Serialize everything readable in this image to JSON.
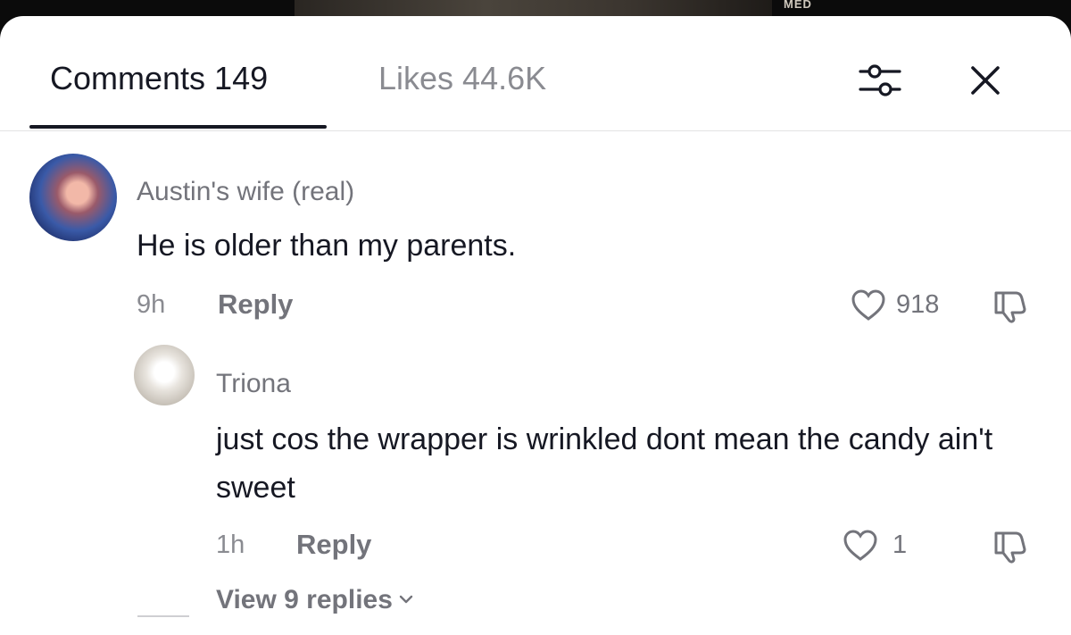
{
  "video": {
    "thumb_text": "MED"
  },
  "header": {
    "tabs": [
      {
        "label": "Comments 149",
        "active": true
      },
      {
        "label": "Likes 44.6K",
        "active": false
      }
    ],
    "filter_icon": "sliders-icon",
    "close_icon": "close-icon"
  },
  "comments": [
    {
      "username": "Austin's wife (real)",
      "text": "He is older than my parents.",
      "time": "9h",
      "reply_label": "Reply",
      "likes": "918"
    },
    {
      "username": "Triona",
      "text": "just cos the wrapper is wrinkled dont mean the candy ain't sweet",
      "time": "1h",
      "reply_label": "Reply",
      "likes": "1"
    }
  ],
  "view_replies": "View 9 replies",
  "colors": {
    "text": "#161823",
    "muted": "#73747b",
    "divider": "#e3e3e4"
  }
}
